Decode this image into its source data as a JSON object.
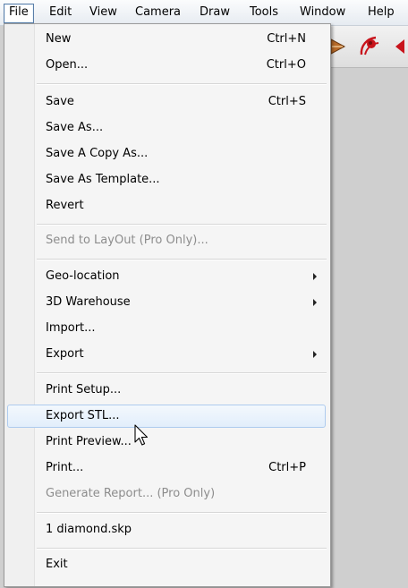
{
  "menubar": {
    "items": [
      {
        "label": "File",
        "active": true
      },
      {
        "label": "Edit"
      },
      {
        "label": "View"
      },
      {
        "label": "Camera"
      },
      {
        "label": "Draw"
      },
      {
        "label": "Tools"
      },
      {
        "label": "Window"
      },
      {
        "label": "Help"
      }
    ]
  },
  "toolbar": {
    "icons": [
      "sketchy-tool-icon",
      "walk-tool-icon",
      "previous-view-icon"
    ]
  },
  "file_menu": {
    "new": {
      "label": "New",
      "shortcut": "Ctrl+N"
    },
    "open": {
      "label": "Open...",
      "shortcut": "Ctrl+O"
    },
    "save": {
      "label": "Save",
      "shortcut": "Ctrl+S"
    },
    "save_as": {
      "label": "Save As..."
    },
    "save_copy_as": {
      "label": "Save A Copy As..."
    },
    "save_as_template": {
      "label": "Save As Template..."
    },
    "revert": {
      "label": "Revert"
    },
    "send_to_layout": {
      "label": "Send to LayOut (Pro Only)...",
      "disabled": true
    },
    "geo_location": {
      "label": "Geo-location",
      "submenu": true
    },
    "warehouse": {
      "label": "3D Warehouse",
      "submenu": true
    },
    "import": {
      "label": "Import..."
    },
    "export": {
      "label": "Export",
      "submenu": true
    },
    "print_setup": {
      "label": "Print Setup..."
    },
    "export_stl": {
      "label": "Export STL...",
      "highlighted": true
    },
    "print_preview": {
      "label": "Print Preview..."
    },
    "print": {
      "label": "Print...",
      "shortcut": "Ctrl+P"
    },
    "generate_report": {
      "label": "Generate Report... (Pro Only)",
      "disabled": true
    },
    "recent_file": {
      "label": "1 diamond.skp"
    },
    "exit": {
      "label": "Exit"
    }
  },
  "colors": {
    "highlight_border": "#aecbee",
    "disabled_text": "#8d8d8d",
    "accent_red": "#c8141c"
  }
}
